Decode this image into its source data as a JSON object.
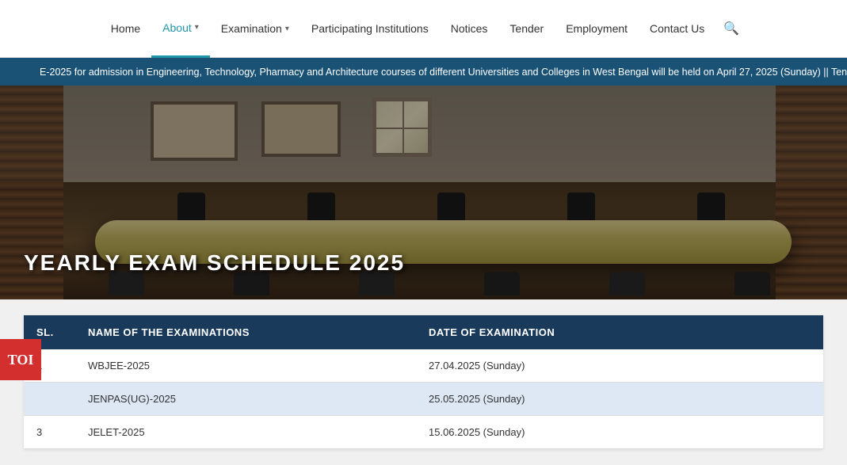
{
  "navbar": {
    "items": [
      {
        "id": "home",
        "label": "Home",
        "active": false,
        "hasDropdown": false
      },
      {
        "id": "about",
        "label": "About",
        "active": true,
        "hasDropdown": true
      },
      {
        "id": "examination",
        "label": "Examination",
        "active": false,
        "hasDropdown": true
      },
      {
        "id": "participating",
        "label": "Participating Institutions",
        "active": false,
        "hasDropdown": false
      },
      {
        "id": "notices",
        "label": "Notices",
        "active": false,
        "hasDropdown": false
      },
      {
        "id": "tender",
        "label": "Tender",
        "active": false,
        "hasDropdown": false
      },
      {
        "id": "employment",
        "label": "Employment",
        "active": false,
        "hasDropdown": false
      },
      {
        "id": "contact",
        "label": "Contact Us",
        "active": false,
        "hasDropdown": false
      }
    ]
  },
  "ticker": {
    "text": "E-2025 for admission in Engineering, Technology, Pharmacy and Architecture courses of different Universities and Colleges in West Bengal will be held on April 27, 2025 (Sunday) ||   Tentative Schedule of Entrance"
  },
  "hero": {
    "title": "YEARLY EXAM SCHEDULE 2025"
  },
  "toi": {
    "label": "TOI"
  },
  "table": {
    "headers": [
      {
        "id": "sl",
        "label": "SL."
      },
      {
        "id": "name",
        "label": "NAME OF THE EXAMINATIONS"
      },
      {
        "id": "date",
        "label": "DATE OF EXAMINATION"
      }
    ],
    "rows": [
      {
        "sl": "1",
        "name": "WBJEE-2025",
        "date": "27.04.2025 (Sunday)"
      },
      {
        "sl": "",
        "name": "JENPAS(UG)-2025",
        "date": "25.05.2025 (Sunday)"
      },
      {
        "sl": "3",
        "name": "JELET-2025",
        "date": "15.06.2025 (Sunday)"
      }
    ]
  }
}
